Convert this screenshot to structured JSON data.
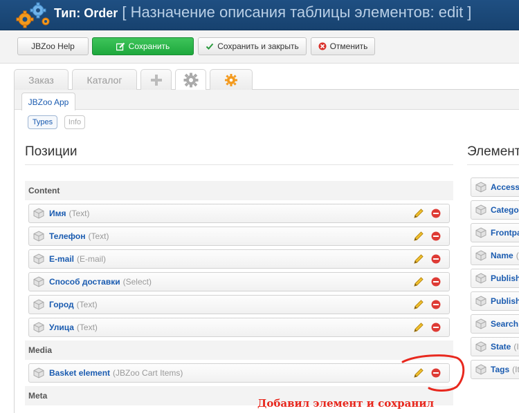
{
  "header": {
    "type_label": "Тип: Order",
    "subtitle": "[ Назначение описания таблицы элементов: edit ]"
  },
  "toolbar": {
    "help_label": "JBZoo Help",
    "save_label": "Сохранить",
    "save_close_label": "Сохранить и закрыть",
    "cancel_label": "Отменить"
  },
  "tabs": [
    {
      "label": "Заказ"
    },
    {
      "label": "Каталог"
    }
  ],
  "subtab": {
    "label": "JBZoo App"
  },
  "filters": {
    "types": "Types",
    "info": "Info"
  },
  "positions": {
    "title": "Позиции",
    "groups": [
      {
        "name": "Content",
        "rows": [
          {
            "name": "Имя",
            "type": "(Text)"
          },
          {
            "name": "Телефон",
            "type": "(Text)"
          },
          {
            "name": "E-mail",
            "type": "(E-mail)"
          },
          {
            "name": "Способ доставки",
            "type": "(Select)"
          },
          {
            "name": "Город",
            "type": "(Text)"
          },
          {
            "name": "Улица",
            "type": "(Text)"
          }
        ]
      },
      {
        "name": "Media",
        "rows": [
          {
            "name": "Basket element",
            "type": "(JBZoo Cart Items)"
          }
        ]
      },
      {
        "name": "Meta",
        "rows": []
      }
    ]
  },
  "elements": {
    "title": "Элемент",
    "items": [
      {
        "name": "Access",
        "type": ""
      },
      {
        "name": "Catego",
        "type": ""
      },
      {
        "name": "Frontpa",
        "type": ""
      },
      {
        "name": "Name",
        "type": "("
      },
      {
        "name": "Publish",
        "type": ""
      },
      {
        "name": "Publish",
        "type": ""
      },
      {
        "name": "Search",
        "type": ""
      },
      {
        "name": "State",
        "type": "(It"
      },
      {
        "name": "Tags",
        "type": "(It"
      }
    ]
  },
  "annotation": "Добавил элемент и сохранил",
  "colors": {
    "header_bg": "#1f4f82",
    "save_green": "#25b043",
    "link_blue": "#1a5bb0",
    "annotation_red": "#e8281e"
  }
}
